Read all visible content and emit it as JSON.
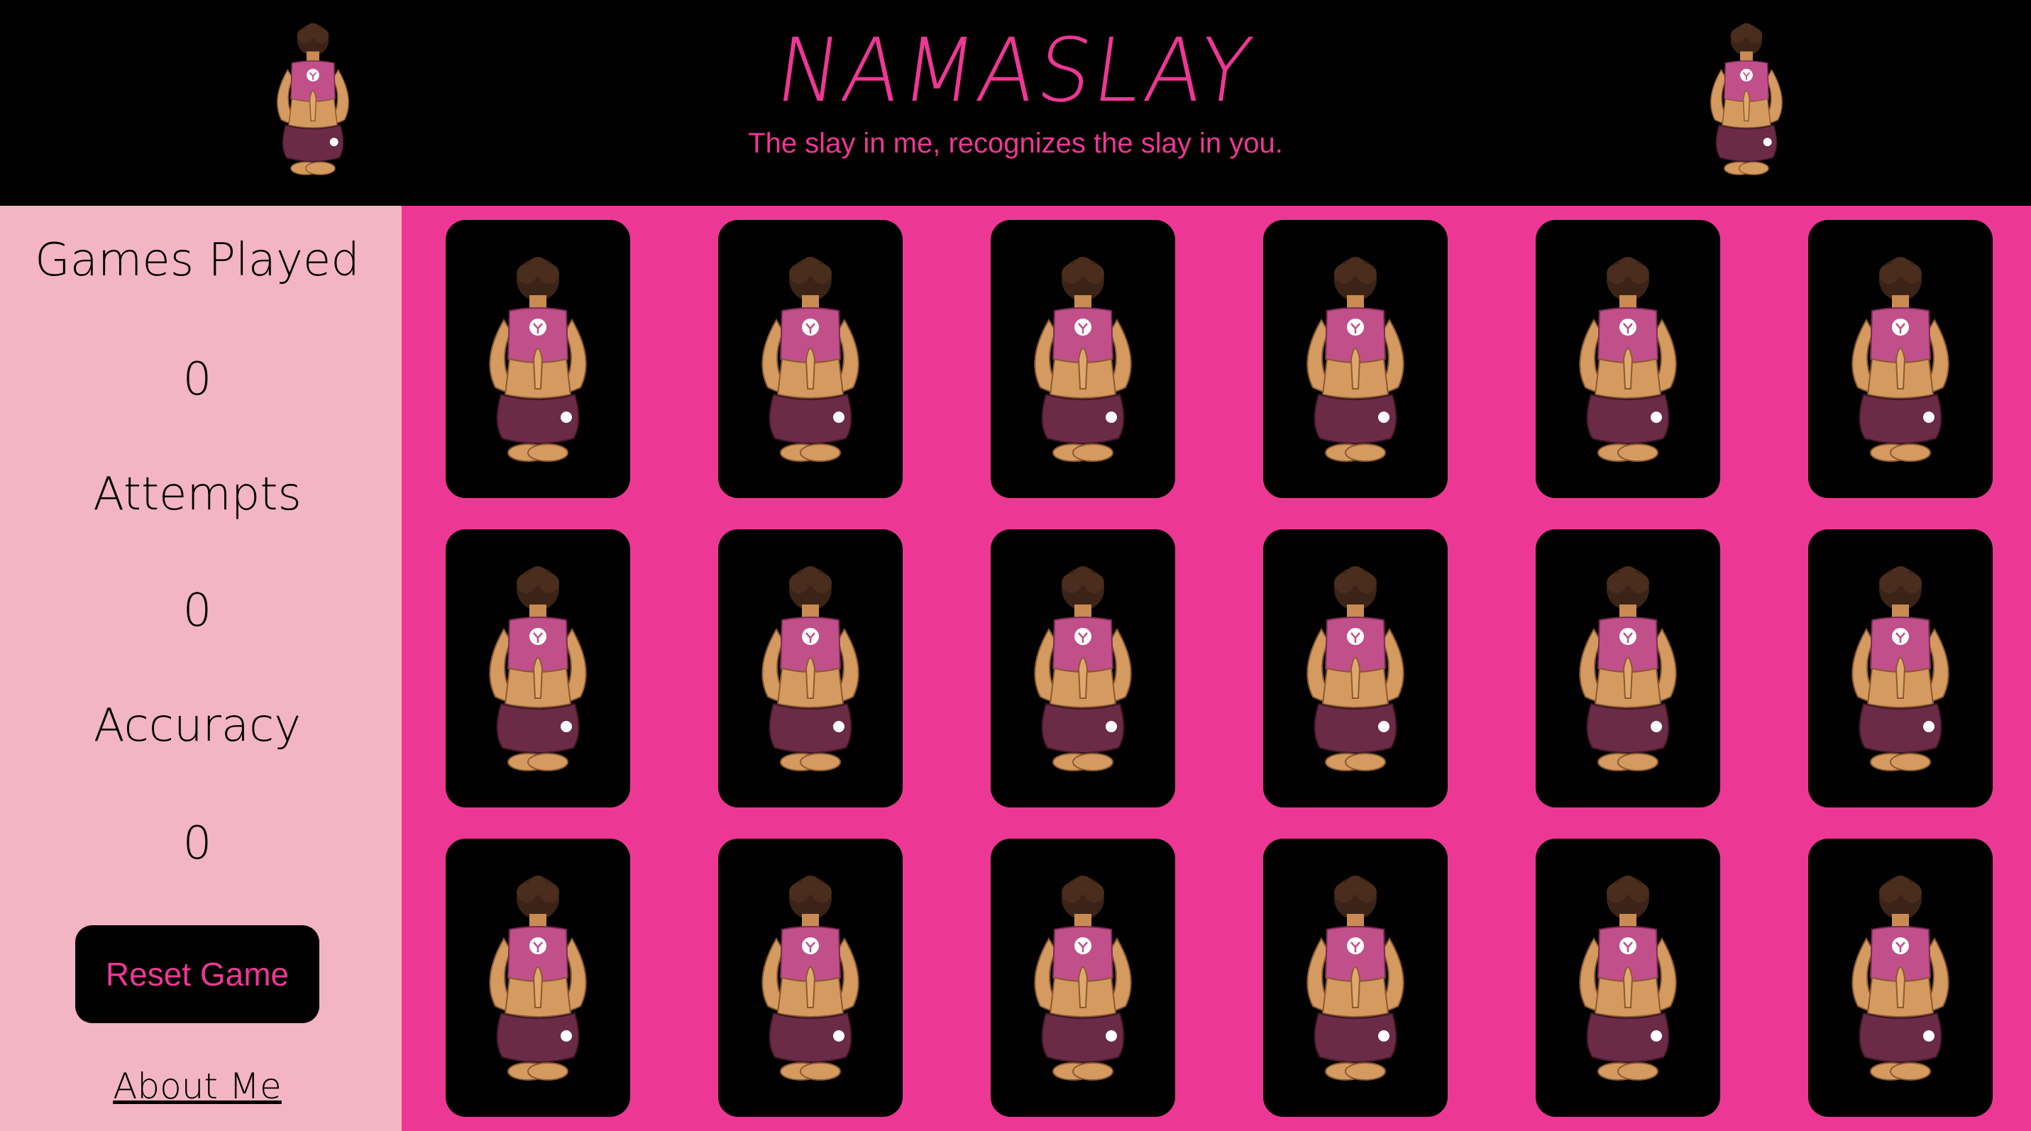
{
  "header": {
    "title": "NAMASLAY",
    "tagline": "The slay in me, recognizes the slay in you.",
    "logo_icon": "meditating-woman-icon"
  },
  "stats": [
    {
      "label": "Games Played",
      "value": "0"
    },
    {
      "label": "Attempts",
      "value": "0"
    },
    {
      "label": "Accuracy",
      "value": "0"
    }
  ],
  "controls": {
    "reset_label": "Reset Game",
    "about_label": "About Me"
  },
  "board": {
    "rows": 3,
    "columns": 6,
    "card_back_icon": "meditating-woman-icon",
    "cards_face_down": 18
  },
  "colors": {
    "accent_pink": "#ec3894",
    "sidebar_pink": "#f3b5c3",
    "header_black": "#000000"
  }
}
